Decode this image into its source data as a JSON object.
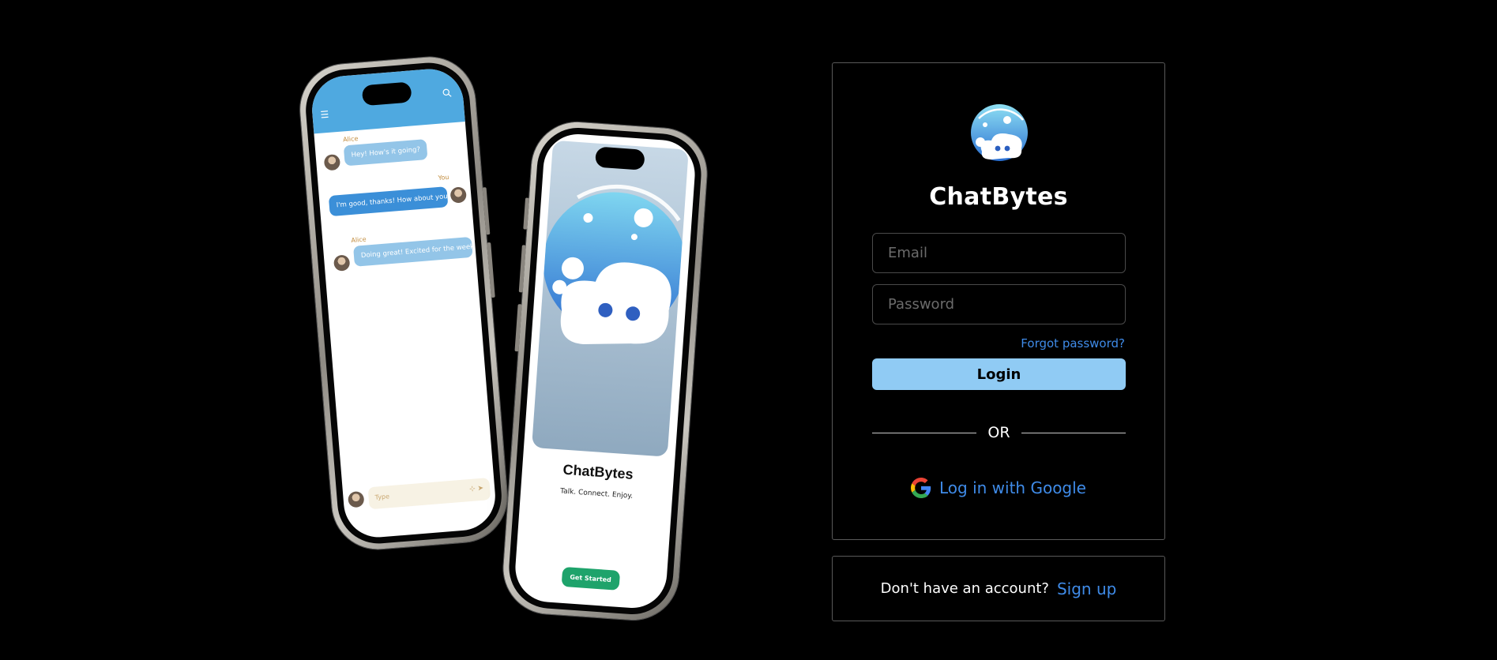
{
  "chat_phone": {
    "messages": [
      {
        "sender": "Alice",
        "text": "Hey! How's it going?",
        "direction": "in"
      },
      {
        "sender": "You",
        "text": "I'm good, thanks! How about you?",
        "direction": "out"
      },
      {
        "sender": "Alice",
        "text": "Doing great! Excited for the weekend",
        "direction": "in"
      }
    ],
    "composer_placeholder": "Type"
  },
  "splash_phone": {
    "title": "ChatBytes",
    "tagline": "Talk. Connect. Enjoy.",
    "button_label": "Get Started"
  },
  "login": {
    "brand": "ChatBytes",
    "email_placeholder": "Email",
    "password_placeholder": "Password",
    "forgot_label": "Forgot password?",
    "login_label": "Login",
    "divider_label": "OR",
    "google_label": "Log in with Google"
  },
  "signup": {
    "prompt": "Don't have an account?",
    "link_label": "Sign up"
  },
  "colors": {
    "background": "#000000",
    "accent_blue": "#3f8be8",
    "login_button": "#90cbf4",
    "get_started_button": "#1ea36b",
    "chat_header": "#4fa9e0"
  },
  "icons": [
    "menu-icon",
    "search-icon",
    "attach-icon",
    "send-icon",
    "google-icon",
    "chatbytes-logo"
  ]
}
